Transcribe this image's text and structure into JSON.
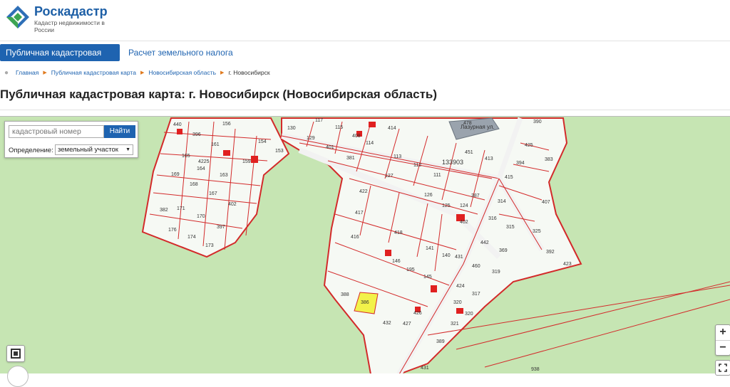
{
  "header": {
    "brand_name": "Роскадастр",
    "brand_subtitle": "Кадастр недвижимости в России"
  },
  "nav": {
    "tabs": [
      {
        "label": "Публичная кадастровая карта",
        "active": true
      },
      {
        "label": "Расчет земельного налога",
        "active": false
      }
    ]
  },
  "breadcrumb": {
    "items": [
      "Главная",
      "Публичная кадастровая карта",
      "Новосибирская область"
    ],
    "current": "г. Новосибирск"
  },
  "page_title": "Публичная кадастровая карта: г. Новосибирск (Новосибирская область)",
  "map_controls": {
    "search_placeholder": "кадастровый номер",
    "search_button": "Найти",
    "definition_label": "Определение:",
    "definition_value": "земельный участок",
    "zoom_in": "+",
    "zoom_out": "−",
    "fullscreen_icon": "fullscreen-icon",
    "layers_icon": "layers-icon"
  },
  "map": {
    "quarter_label": "133903",
    "street_label": "Лазурная ул.",
    "highlighted_parcel": "386",
    "parcel_labels": [
      "440",
      "396",
      "156",
      "161",
      "165",
      "4225",
      "164",
      "163",
      "169",
      "168",
      "167",
      "402",
      "382",
      "171",
      "170",
      "397",
      "176",
      "174",
      "173",
      "159",
      "154",
      "153",
      "130",
      "129",
      "117",
      "115",
      "401",
      "408",
      "414",
      "381",
      "114",
      "113",
      "112",
      "111",
      "127",
      "422",
      "126",
      "417",
      "125",
      "124",
      "402",
      "387",
      "478",
      "390",
      "451",
      "413",
      "425",
      "394",
      "383",
      "415",
      "314",
      "316",
      "407",
      "315",
      "325",
      "416",
      "418",
      "146",
      "141",
      "140",
      "442",
      "369",
      "392",
      "460",
      "319",
      "423",
      "195",
      "145",
      "431",
      "424",
      "317",
      "388",
      "386",
      "426",
      "320",
      "427",
      "432",
      "321",
      "389",
      "431",
      "938",
      "320"
    ],
    "colors": {
      "background": "#c6e5b3",
      "parcel_fill": "#ffffff",
      "parcel_border": "#d32a2a",
      "building": "#e02020",
      "highlight": "#f2f24a",
      "road": "#f3f3f3"
    }
  }
}
